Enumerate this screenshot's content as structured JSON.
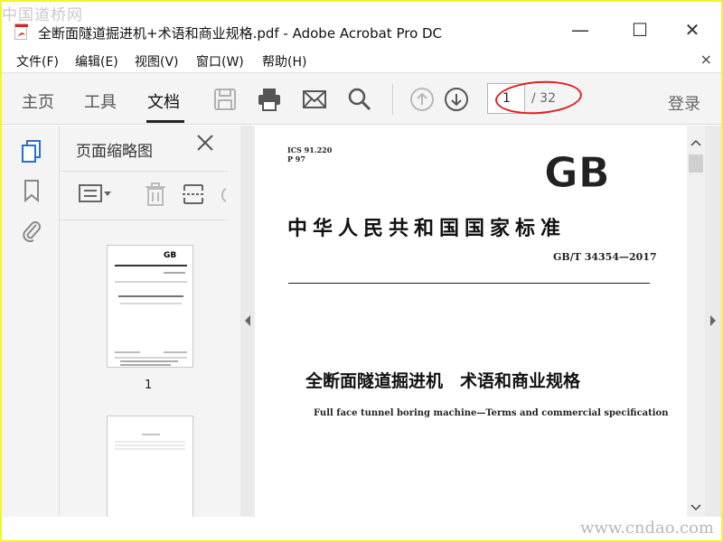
{
  "watermark_top": "中国道桥网",
  "watermark_bottom": "www.cndao.com",
  "window": {
    "title": "全断面隧道掘进机+术语和商业规格.pdf - Adobe Acrobat Pro DC",
    "minimize": "—",
    "maximize": "☐",
    "close": "✕"
  },
  "menu": {
    "items": [
      "文件(F)",
      "编辑(E)",
      "视图(V)",
      "窗口(W)",
      "帮助(H)"
    ],
    "close": "×"
  },
  "toolbar": {
    "tabs": [
      "主页",
      "工具",
      "文档"
    ],
    "page_current": "1",
    "page_total": "/ 32",
    "login": "登录",
    "icons": [
      "save-icon",
      "print-icon",
      "email-icon",
      "search-icon",
      "page-up-icon",
      "page-down-icon"
    ]
  },
  "panel": {
    "title": "页面缩略图",
    "thumbnail_label": "1"
  },
  "document": {
    "ics": "ICS 91.220",
    "p": "P 97",
    "gb_logo": "GB",
    "heading": "中华人民共和国国家标准",
    "code": "GB/T 34354—2017",
    "title": "全断面隧道掘进机　术语和商业规格",
    "subtitle": "Full face tunnel boring machine—Terms and commercial specification"
  },
  "colors": {
    "accent_blue": "#2a6fc9",
    "highlight_red": "#e02020",
    "border_yellow": "#f2f52a"
  }
}
